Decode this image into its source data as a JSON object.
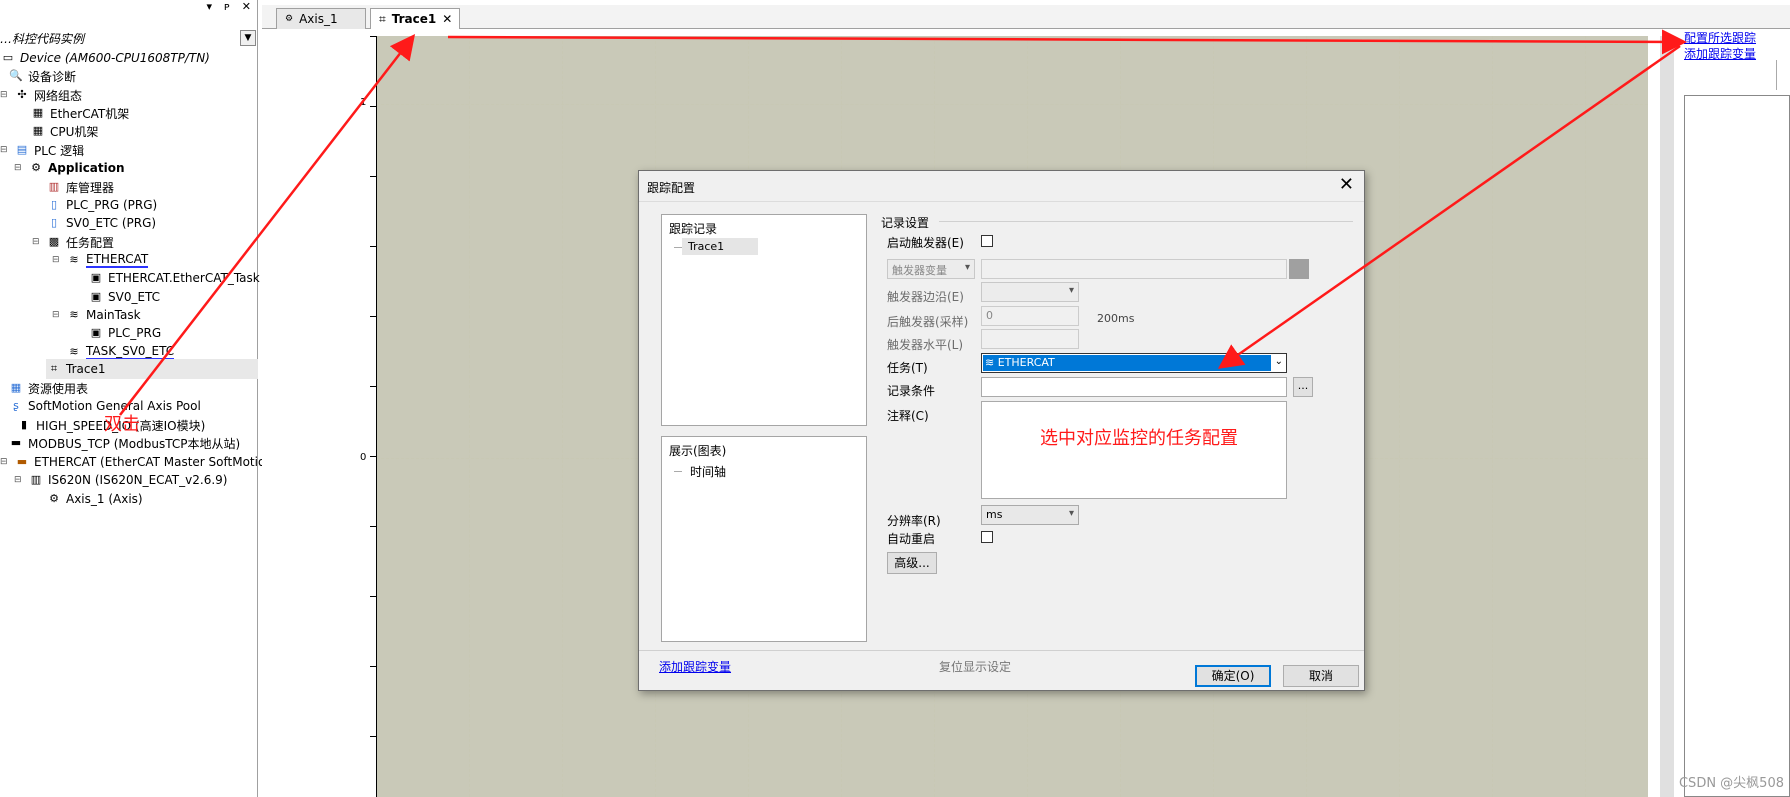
{
  "tree": {
    "project_name": "…科控代码实例",
    "items": [
      {
        "label": "Device (AM600-CPU1608TP/TN)",
        "icon": "device-icon"
      },
      {
        "label": "设备诊断",
        "icon": "diagnosis-icon"
      },
      {
        "label": "网络组态",
        "icon": "network-icon"
      },
      {
        "label": "EtherCAT机架",
        "icon": "rack-icon"
      },
      {
        "label": "CPU机架",
        "icon": "rack-icon"
      },
      {
        "label": "PLC 逻辑",
        "icon": "plc-logic-icon"
      },
      {
        "label": "Application",
        "icon": "gear-icon"
      },
      {
        "label": "库管理器",
        "icon": "library-icon"
      },
      {
        "label": "PLC_PRG (PRG)",
        "icon": "program-icon"
      },
      {
        "label": "SV0_ETC (PRG)",
        "icon": "program-icon"
      },
      {
        "label": "任务配置",
        "icon": "task-config-icon"
      },
      {
        "label": "ETHERCAT",
        "icon": "task-icon"
      },
      {
        "label": "ETHERCAT.EtherCAT_Task",
        "icon": "call-icon"
      },
      {
        "label": "SV0_ETC",
        "icon": "call-icon"
      },
      {
        "label": "MainTask",
        "icon": "task-icon"
      },
      {
        "label": "PLC_PRG",
        "icon": "call-icon"
      },
      {
        "label": "TASK_SV0_ETC",
        "icon": "task-icon"
      },
      {
        "label": "Trace1",
        "icon": "trace-icon"
      },
      {
        "label": "资源使用表",
        "icon": "table-icon"
      },
      {
        "label": "SoftMotion General Axis Pool",
        "icon": "axis-pool-icon"
      },
      {
        "label": "HIGH_SPEED_IO (高速IO模块)",
        "icon": "module-icon"
      },
      {
        "label": "MODBUS_TCP (ModbusTCP本地从站)",
        "icon": "module-icon"
      },
      {
        "label": "ETHERCAT (EtherCAT Master SoftMotion)",
        "icon": "module-icon"
      },
      {
        "label": "IS620N (IS620N_ECAT_v2.6.9)",
        "icon": "drive-icon"
      },
      {
        "label": "Axis_1 (Axis)",
        "icon": "axis-icon"
      }
    ]
  },
  "tabs": [
    {
      "label": "Axis_1"
    },
    {
      "label": "Trace1"
    }
  ],
  "plot": {
    "y_labels": [
      "1",
      "0"
    ]
  },
  "right_links": {
    "configure": "配置所选跟踪",
    "add_var": "添加跟踪变量"
  },
  "dialog": {
    "title": "跟踪配置",
    "record_box_title": "跟踪记录",
    "record_item": "Trace1",
    "display_box_title": "展示(图表)",
    "display_item": "时间轴",
    "record_settings": "记录设置",
    "enable_trigger": "启动触发器(E)",
    "trigger_var": "触发器变量",
    "trigger_edge": "触发器边沿(E)",
    "post_trigger": "后触发器(采样)",
    "post_trigger_value": "0",
    "post_trigger_unit": "200ms",
    "trigger_level": "触发器水平(L)",
    "task_label": "任务(T)",
    "task_value": "ETHERCAT",
    "record_condition": "记录条件",
    "comment_label": "注释(C)",
    "resolution_label": "分辨率(R)",
    "resolution_value": "ms",
    "auto_restart": "自动重启",
    "advanced": "高级...",
    "add_var_link": "添加跟踪变量",
    "reset_display": "复位显示设定",
    "ok": "确定(O)",
    "cancel": "取消",
    "ellipsis": "..."
  },
  "annotations": {
    "double_click": "双击",
    "select_task": "选中对应监控的任务配置"
  },
  "watermark": "CSDN @尖枫508",
  "colors": {
    "plot_bg": "#fafae8",
    "highlight": "#0078d7",
    "annotation": "#ff1a1a",
    "link": "#0000ee"
  }
}
